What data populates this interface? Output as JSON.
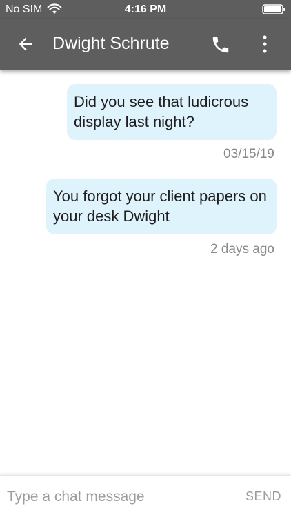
{
  "status_bar": {
    "carrier": "No SIM",
    "time": "4:16 PM",
    "icons": [
      "wifi-icon",
      "battery-icon"
    ]
  },
  "header": {
    "back_icon": "arrow-left-icon",
    "title": "Dwight Schrute",
    "call_icon": "phone-icon",
    "more_icon": "more-vert-icon",
    "background": "#5e5e5e"
  },
  "messages": [
    {
      "text": "Did you see that ludicrous display last night?",
      "timestamp": "03/15/19"
    },
    {
      "text": "You forgot your client papers on your desk Dwight",
      "timestamp": "2 days ago"
    }
  ],
  "bubble_color": "#dff3fc",
  "composer": {
    "placeholder": "Type a chat message",
    "value": "",
    "send_label": "SEND"
  }
}
